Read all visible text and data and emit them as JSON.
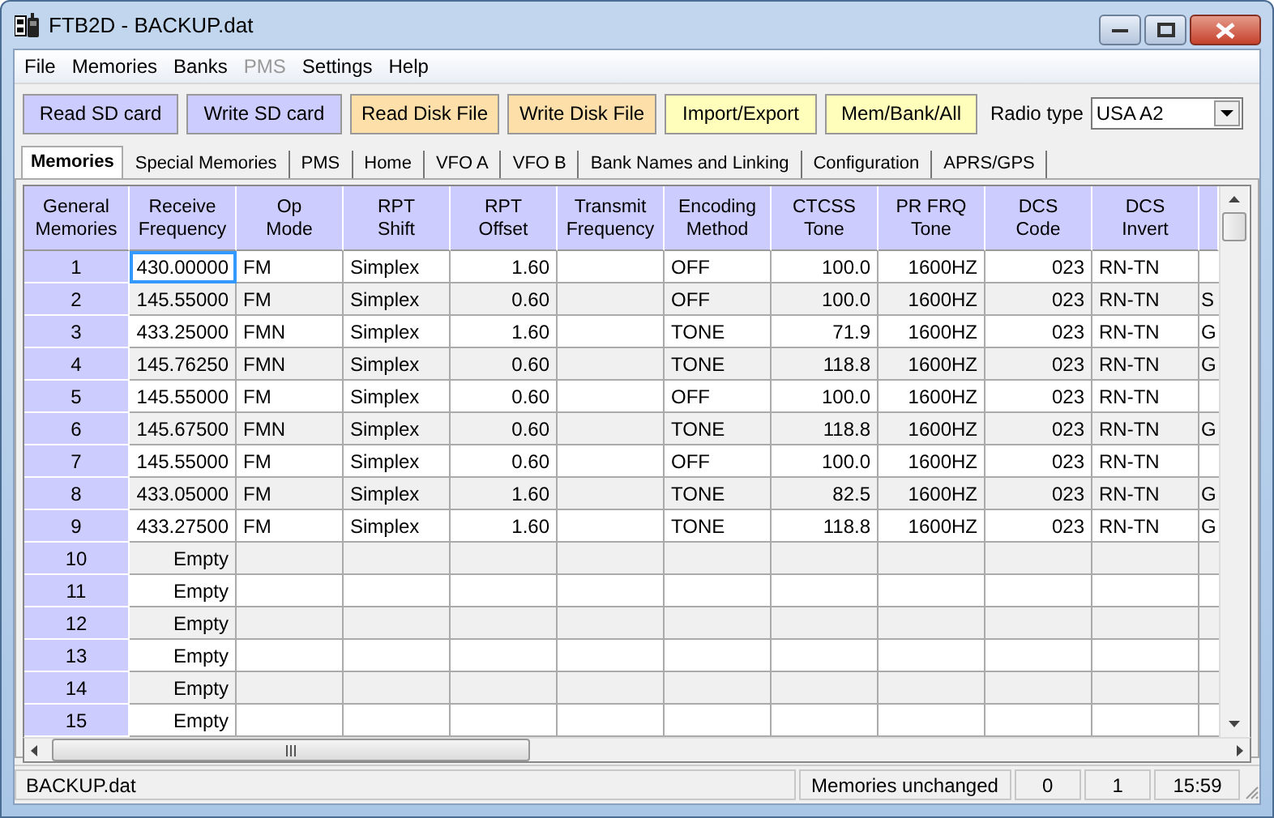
{
  "window": {
    "title": "FTB2D - BACKUP.dat"
  },
  "menu": [
    {
      "label": "File",
      "disabled": false
    },
    {
      "label": "Memories",
      "disabled": false
    },
    {
      "label": "Banks",
      "disabled": false
    },
    {
      "label": "PMS",
      "disabled": true
    },
    {
      "label": "Settings",
      "disabled": false
    },
    {
      "label": "Help",
      "disabled": false
    }
  ],
  "toolbar": {
    "buttons": [
      {
        "label": "Read SD card",
        "color": "#ccccff"
      },
      {
        "label": "Write SD card",
        "color": "#ccccff"
      },
      {
        "label": "Read Disk File",
        "color": "#fddfaa"
      },
      {
        "label": "Write Disk File",
        "color": "#fddfaa"
      },
      {
        "label": "Import/Export",
        "color": "#ffffbb"
      },
      {
        "label": "Mem/Bank/All",
        "color": "#ffffbb"
      }
    ],
    "radio_type": {
      "label": "Radio type",
      "value": "USA A2"
    }
  },
  "tabs": [
    {
      "label": "Memories",
      "selected": true
    },
    {
      "label": "Special Memories",
      "selected": false
    },
    {
      "label": "PMS",
      "selected": false
    },
    {
      "label": "Home",
      "selected": false
    },
    {
      "label": "VFO A",
      "selected": false
    },
    {
      "label": "VFO B",
      "selected": false
    },
    {
      "label": "Bank Names and Linking",
      "selected": false
    },
    {
      "label": "Configuration",
      "selected": false
    },
    {
      "label": "APRS/GPS",
      "selected": false
    }
  ],
  "table": {
    "columns": [
      "General\nMemories",
      "Receive\nFrequency",
      "Op\nMode",
      "RPT\nShift",
      "RPT\nOffset",
      "Transmit\nFrequency",
      "Encoding\nMethod",
      "CTCSS\nTone",
      "PR FRQ\nTone",
      "DCS\nCode",
      "DCS\nInvert"
    ],
    "rows": [
      {
        "cells": [
          "1",
          "430.00000",
          "FM",
          "Simplex",
          "1.60",
          "",
          "OFF",
          "100.0",
          "1600HZ",
          "023",
          "RN-TN"
        ],
        "focused": true
      },
      {
        "cells": [
          "2",
          "145.55000",
          "FM",
          "Simplex",
          "0.60",
          "",
          "OFF",
          "100.0",
          "1600HZ",
          "023",
          "RN-TN",
          "S"
        ],
        "focused": false
      },
      {
        "cells": [
          "3",
          "433.25000",
          "FMN",
          "Simplex",
          "1.60",
          "",
          "TONE",
          "71.9",
          "1600HZ",
          "023",
          "RN-TN",
          "G"
        ],
        "focused": false
      },
      {
        "cells": [
          "4",
          "145.76250",
          "FMN",
          "Simplex",
          "0.60",
          "",
          "TONE",
          "118.8",
          "1600HZ",
          "023",
          "RN-TN",
          "G"
        ],
        "focused": false
      },
      {
        "cells": [
          "5",
          "145.55000",
          "FM",
          "Simplex",
          "0.60",
          "",
          "OFF",
          "100.0",
          "1600HZ",
          "023",
          "RN-TN"
        ],
        "focused": false
      },
      {
        "cells": [
          "6",
          "145.67500",
          "FMN",
          "Simplex",
          "0.60",
          "",
          "TONE",
          "118.8",
          "1600HZ",
          "023",
          "RN-TN",
          "G"
        ],
        "focused": false
      },
      {
        "cells": [
          "7",
          "145.55000",
          "FM",
          "Simplex",
          "0.60",
          "",
          "OFF",
          "100.0",
          "1600HZ",
          "023",
          "RN-TN"
        ],
        "focused": false
      },
      {
        "cells": [
          "8",
          "433.05000",
          "FM",
          "Simplex",
          "1.60",
          "",
          "TONE",
          "82.5",
          "1600HZ",
          "023",
          "RN-TN",
          "G"
        ],
        "focused": false
      },
      {
        "cells": [
          "9",
          "433.27500",
          "FM",
          "Simplex",
          "1.60",
          "",
          "TONE",
          "118.8",
          "1600HZ",
          "023",
          "RN-TN",
          "G"
        ],
        "focused": false
      },
      {
        "cells": [
          "10",
          "Empty"
        ],
        "focused": false
      },
      {
        "cells": [
          "11",
          "Empty"
        ],
        "focused": false
      },
      {
        "cells": [
          "12",
          "Empty"
        ],
        "focused": false
      },
      {
        "cells": [
          "13",
          "Empty"
        ],
        "focused": false
      },
      {
        "cells": [
          "14",
          "Empty"
        ],
        "focused": false
      },
      {
        "cells": [
          "15",
          "Empty"
        ],
        "focused": false
      }
    ]
  },
  "status_bar": [
    "BACKUP.dat",
    "Memories unchanged",
    "0",
    "1",
    "15:59"
  ]
}
